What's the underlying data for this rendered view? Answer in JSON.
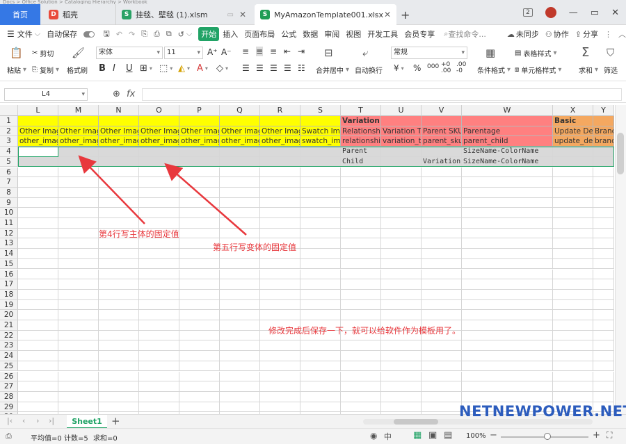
{
  "titlebar": {
    "top_strip": "Docs  >  Office Solution  >  Cataloging Hierarchy  >  Workbook",
    "home_tab": "首页",
    "tabs": [
      {
        "label": "稻壳",
        "color": "#e94b3c",
        "icon": "D"
      },
      {
        "label": "挂毯、壁毯 (1).xlsm",
        "color": "#2aa266",
        "icon": "S"
      },
      {
        "label": "MyAmazonTemplate001.xlsx",
        "color": "#1f9d55",
        "icon": "S"
      }
    ],
    "add_tab": "+",
    "badge": "2"
  },
  "menubar": {
    "file": "文件",
    "autosave": "自动保存",
    "start": "开始",
    "items": [
      "插入",
      "页面布局",
      "公式",
      "数据",
      "审阅",
      "视图",
      "开发工具",
      "会员专享"
    ],
    "search": "查找命令...",
    "unsynced": "未同步",
    "collab": "协作",
    "share": "分享"
  },
  "ribbon": {
    "cut": "剪切",
    "copy": "复制",
    "paste": "粘贴",
    "format_painter": "格式刷",
    "font": "宋体",
    "font_size": "11",
    "merge": "合并居中",
    "wrap": "自动换行",
    "number_format": "常规",
    "cond_format": "条件格式",
    "table_style": "表格样式",
    "cell_style": "单元格样式",
    "sum": "求和",
    "filter": "筛选"
  },
  "formula_bar": {
    "name_box": "L4",
    "fx": "fx",
    "value": ""
  },
  "columns": [
    {
      "id": "L",
      "w": 58
    },
    {
      "id": "M",
      "w": 58
    },
    {
      "id": "N",
      "w": 58
    },
    {
      "id": "O",
      "w": 58
    },
    {
      "id": "P",
      "w": 58
    },
    {
      "id": "Q",
      "w": 58
    },
    {
      "id": "R",
      "w": 58
    },
    {
      "id": "S",
      "w": 58
    },
    {
      "id": "T",
      "w": 58
    },
    {
      "id": "U",
      "w": 58
    },
    {
      "id": "V",
      "w": 58
    },
    {
      "id": "W",
      "w": 131
    },
    {
      "id": "X",
      "w": 58
    },
    {
      "id": "Y",
      "w": 30
    }
  ],
  "rows": [
    "1",
    "2",
    "3",
    "4",
    "5",
    "6",
    "7",
    "8",
    "9",
    "10",
    "11",
    "12",
    "13",
    "14",
    "15",
    "16",
    "17",
    "18",
    "19",
    "20",
    "21",
    "22",
    "23",
    "24",
    "25",
    "26",
    "27",
    "28",
    "29",
    "30"
  ],
  "cells": {
    "row1": [
      "",
      "",
      "",
      "",
      "",
      "",
      "",
      "",
      "Variation",
      "",
      "",
      "",
      "Basic",
      ""
    ],
    "row2": [
      "Other Image",
      "Other Image",
      "Other Image",
      "Other Image",
      "Other Image",
      "Other Image",
      "Other Image",
      "Swatch Image",
      "Relationship",
      "Variation Theme",
      "Parent SKU",
      "Parentage",
      "Update Delete",
      "Brand"
    ],
    "row3": [
      "other_image",
      "other_image",
      "other_image",
      "other_image",
      "other_image",
      "other_image",
      "other_image",
      "swatch_image",
      "relationship",
      "variation_theme",
      "parent_sku",
      "parent_child",
      "update_delete",
      "brand"
    ],
    "row4": [
      "",
      "",
      "",
      "",
      "",
      "",
      "",
      "",
      "Parent",
      "",
      "",
      "SizeName-ColorName",
      "",
      ""
    ],
    "row5": [
      "",
      "",
      "",
      "",
      "",
      "",
      "",
      "",
      "Child",
      "",
      "Variation",
      "SizeName-ColorName",
      "",
      ""
    ]
  },
  "colors": {
    "yellow": "#ffff00",
    "red": "#ff8080",
    "orange": "#f4a860",
    "selected_rows": "#d9d9d9",
    "green_accent": "#21a366",
    "annotation": "#e8383d"
  },
  "annotations": {
    "row4_note": "第4行写主体的固定值",
    "row5_note": "第五行写变体的固定值",
    "save_note": "修改完成后保存一下，就可以给软件作为模板用了。"
  },
  "sheet": {
    "name": "Sheet1",
    "add": "+"
  },
  "status": {
    "average": "平均值=0",
    "count": "计数=5",
    "sum": "求和=0",
    "zoom": "100%"
  },
  "watermark": "NETNEWPOWER.NET"
}
